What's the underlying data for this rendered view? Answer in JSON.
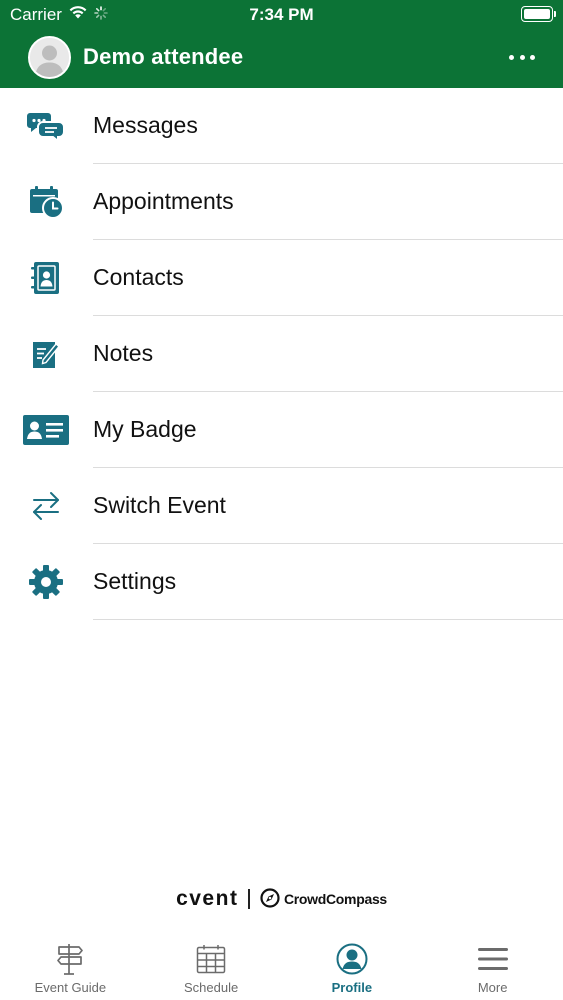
{
  "status_bar": {
    "carrier": "Carrier",
    "time": "7:34 PM",
    "wifi_icon": "wifi-icon",
    "activity_icon": "activity-spinner-icon",
    "battery_icon": "battery-icon"
  },
  "header": {
    "user_name": "Demo attendee",
    "avatar_icon": "avatar-placeholder-icon",
    "more_icon": "more-horizontal-icon",
    "background_color": "#0c7336"
  },
  "menu": {
    "icon_color": "#1a6f82",
    "items": [
      {
        "label": "Messages",
        "icon": "messages-icon"
      },
      {
        "label": "Appointments",
        "icon": "calendar-clock-icon"
      },
      {
        "label": "Contacts",
        "icon": "address-book-icon"
      },
      {
        "label": "Notes",
        "icon": "notes-icon"
      },
      {
        "label": "My Badge",
        "icon": "badge-icon"
      },
      {
        "label": "Switch Event",
        "icon": "switch-arrows-icon"
      },
      {
        "label": "Settings",
        "icon": "gear-icon"
      }
    ]
  },
  "branding": {
    "primary": "cvent",
    "secondary": "CrowdCompass"
  },
  "tabbar": {
    "active_color": "#1a6f82",
    "tabs": [
      {
        "label": "Event Guide",
        "icon": "signpost-icon",
        "active": false
      },
      {
        "label": "Schedule",
        "icon": "calendar-grid-icon",
        "active": false
      },
      {
        "label": "Profile",
        "icon": "profile-icon",
        "active": true
      },
      {
        "label": "More",
        "icon": "hamburger-menu-icon",
        "active": false
      }
    ]
  }
}
